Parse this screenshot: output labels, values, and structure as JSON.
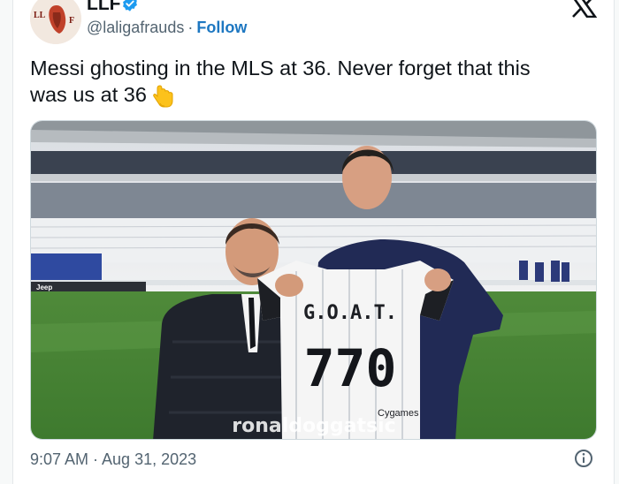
{
  "tweet": {
    "author": {
      "display_name": "LLF",
      "handle": "@laligafrauds",
      "verified": true,
      "avatar_text": "LL F"
    },
    "separator": "·",
    "follow_label": "Follow",
    "text_line1": "Messi ghosting in the MLS at 36.  Never forget that this",
    "text_line2": "was us at 36",
    "emoji": "pointing-down-hand-icon",
    "media": {
      "shirt_text": "G.O.A.T.",
      "shirt_number": "770",
      "sponsor": "Cygames",
      "watermark": "ronaldoggatsic",
      "board_text": "Jeep"
    },
    "timestamp": "9:07 AM · Aug 31, 2023"
  },
  "colors": {
    "follow": "#1d77c1",
    "verified": "#1d9bf0",
    "text": "#0f1419",
    "muted": "#536471"
  }
}
